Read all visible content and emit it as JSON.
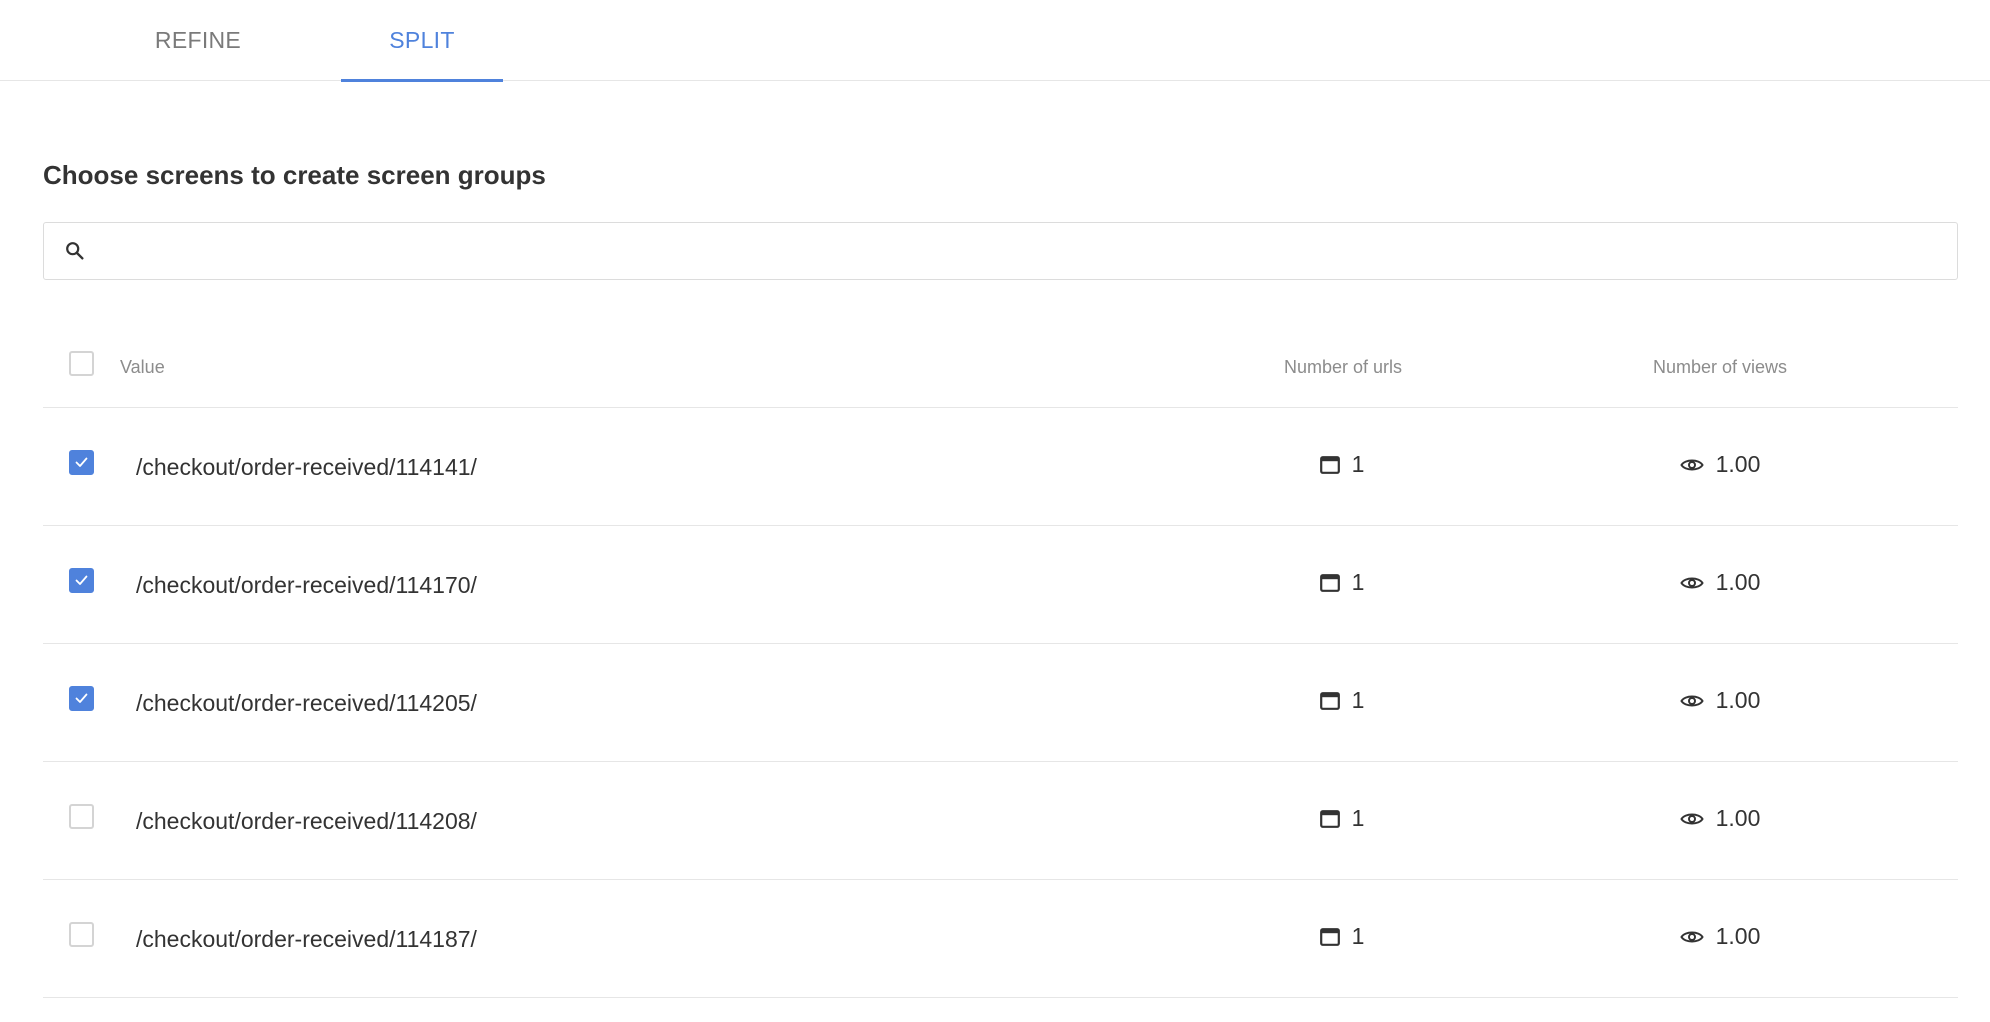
{
  "tabs": [
    {
      "label": "REFINE",
      "active": false
    },
    {
      "label": "SPLIT",
      "active": true
    }
  ],
  "heading": "Choose screens to create screen groups",
  "search": {
    "placeholder": "",
    "value": ""
  },
  "table": {
    "columns": {
      "value": "Value",
      "urls": "Number of urls",
      "views": "Number of views"
    },
    "rows": [
      {
        "value": "/checkout/order-received/114141/",
        "urls": "1",
        "views": "1.00",
        "checked": true
      },
      {
        "value": "/checkout/order-received/114170/",
        "urls": "1",
        "views": "1.00",
        "checked": true
      },
      {
        "value": "/checkout/order-received/114205/",
        "urls": "1",
        "views": "1.00",
        "checked": true
      },
      {
        "value": "/checkout/order-received/114208/",
        "urls": "1",
        "views": "1.00",
        "checked": false
      },
      {
        "value": "/checkout/order-received/114187/",
        "urls": "1",
        "views": "1.00",
        "checked": false
      }
    ]
  },
  "colors": {
    "accent": "#4f82dc",
    "text": "#333333",
    "muted": "#8c8c8c",
    "border": "#e6e6e6"
  },
  "icons": {
    "search": "search-icon",
    "urls": "window-icon",
    "views": "eye-icon",
    "check": "check-icon"
  }
}
